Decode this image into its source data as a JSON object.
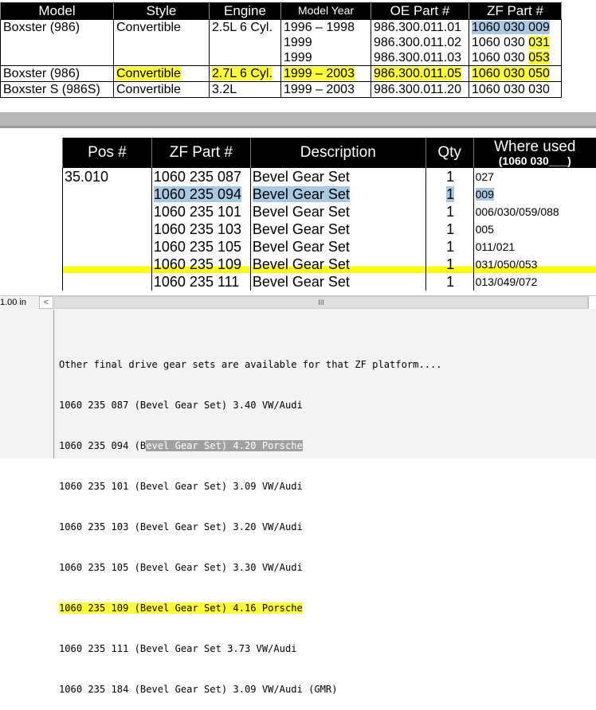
{
  "top_table": {
    "headers": [
      "Model",
      "Style",
      "Engine",
      "Model Year",
      "OE Part #",
      "ZF Part #"
    ],
    "rows": [
      {
        "model": "Boxster (986)",
        "style": "Convertible",
        "engine": "2.5L 6 Cyl.",
        "years": [
          "1996 – 1998",
          "1999",
          "1999"
        ],
        "oe": [
          "986.300.011.01",
          "986.300.011.02",
          "986.300.011.03"
        ],
        "zf": [
          [
            "1060 030 009",
            ""
          ],
          [
            "1060 030 ",
            "031"
          ],
          [
            "1060 030 ",
            "053"
          ]
        ]
      },
      {
        "model": "Boxster (986)",
        "style": "Convertible",
        "engine": "2.7L 6 Cyl.",
        "years": [
          "1999 – 2003"
        ],
        "oe": [
          "986.300.011.05"
        ],
        "zf": [
          [
            "1060 030 050",
            ""
          ]
        ]
      },
      {
        "model": "Boxster S (986S)",
        "style": "Convertible",
        "engine": "3.2L",
        "years": [
          "1999 – 2003"
        ],
        "oe": [
          "986.300.011.20"
        ],
        "zf": [
          [
            "1060 030 030",
            ""
          ]
        ]
      }
    ]
  },
  "gear_table": {
    "headers": {
      "pos": "Pos #",
      "zf": "ZF Part #",
      "desc": "Description",
      "qty": "Qty",
      "where": "Where used",
      "where_sub": "(1060 030___)"
    },
    "pos_value": "35.010",
    "rows": [
      {
        "zf": "1060 235 087",
        "desc": "Bevel Gear Set",
        "qty": "1",
        "where": "027"
      },
      {
        "zf": "1060 235 094",
        "desc": "Bevel Gear Set",
        "qty": "1",
        "where": "009"
      },
      {
        "zf": "1060 235 101",
        "desc": "Bevel Gear Set",
        "qty": "1",
        "where": "006/030/059/088"
      },
      {
        "zf": "1060 235 103",
        "desc": "Bevel Gear Set",
        "qty": "1",
        "where": "005"
      },
      {
        "zf": "1060 235 105",
        "desc": "Bevel Gear Set",
        "qty": "1",
        "where": "011/021"
      },
      {
        "zf": "1060 235 109",
        "desc": "Bevel Gear Set",
        "qty": "1",
        "where": "031/050/053"
      },
      {
        "zf": "1060 235 111",
        "desc": "Bevel Gear Set",
        "qty": "1",
        "where": "013/049/072"
      }
    ]
  },
  "ruler": {
    "label": "1.00 in",
    "left_arrow": "<",
    "thumb_grip": "III"
  },
  "text_panel": {
    "intro": "Other final drive gear sets are available for that ZF platform....",
    "lines": [
      "1060 235 087 (Bevel Gear Set) 3.40 VW/Audi",
      "1060 235 094 (B",
      "1060 235 101 (Bevel Gear Set) 3.09 VW/Audi",
      "1060 235 103 (Bevel Gear Set) 3.20 VW/Audi",
      "1060 235 105 (Bevel Gear Set) 3.30 VW/Audi",
      "1060 235 109 (Bevel Gear Set) 4.16 Porsche",
      "1060 235 111 (Bevel Gear Set 3.73 VW/Audi",
      "1060 235 184 (Bevel Gear Set) 3.09 VW/Audi (GMR)"
    ],
    "line2_selected": "evel Gear Set) 4.20 Porsche"
  },
  "colors": {
    "highlight_yellow": "#ffff33",
    "highlight_blue": "#a8c8e4",
    "header_black": "#000000"
  }
}
